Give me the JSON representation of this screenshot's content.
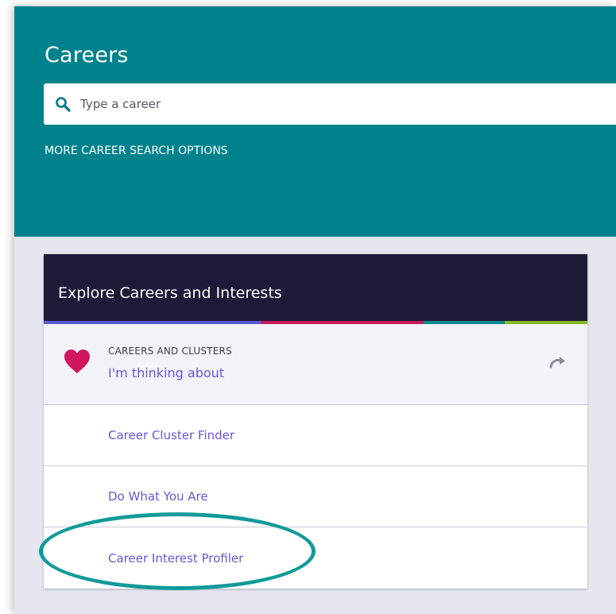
{
  "header": {
    "title": "Careers",
    "search_placeholder": "Type a career",
    "more_options": "MORE CAREER SEARCH OPTIONS",
    "background_color": "#00828c"
  },
  "card": {
    "title": "Explore Careers and Interests",
    "header_color": "#1c1b38",
    "stripe_colors": [
      "#5b5bd6",
      "#c8185a",
      "#0a8c8c",
      "#86b820"
    ],
    "featured": {
      "kicker": "CAREERS AND CLUSTERS",
      "link": "I'm thinking about",
      "icon": "heart-icon",
      "action_icon": "redo-icon"
    },
    "links": [
      "Career Cluster Finder",
      "Do What You Are",
      "Career Interest Profiler"
    ],
    "link_color": "#6c54d8"
  },
  "annotation": {
    "highlighted_item": "Career Interest Profiler",
    "ring_color": "#119a9a"
  }
}
